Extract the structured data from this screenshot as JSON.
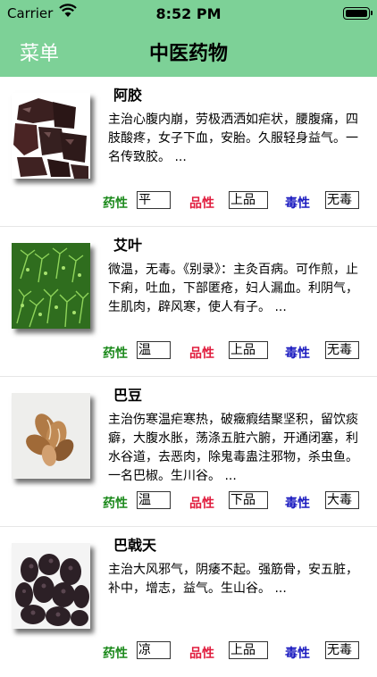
{
  "status_bar": {
    "carrier": "Carrier",
    "time": "8:52 PM"
  },
  "nav": {
    "menu_label": "菜单",
    "title": "中医药物"
  },
  "tag_labels": {
    "nature": "药性",
    "grade": "品性",
    "toxicity": "毒性"
  },
  "colors": {
    "nav_green": "#7dd197",
    "nature_label": "#1c8a1c",
    "grade_label": "#e01b3c",
    "toxicity_label": "#1a1abf"
  },
  "herbs": [
    {
      "name": "阿胶",
      "description": "主治心腹内崩，劳极洒洒如疟状，腰腹痛，四肢酸疼，女子下血，安胎。久服轻身益气。一名传致胶。 ...",
      "nature": "平",
      "grade": "上品",
      "toxicity": "无毒",
      "image": "ejiao-photo"
    },
    {
      "name": "艾叶",
      "description": "微温，无毒。《别录》：主灸百病。可作煎，止下痢，吐血，下部匿疮，妇人漏血。利阴气，生肌肉，辟风寒，使人有子。 ...",
      "nature": "温",
      "grade": "上品",
      "toxicity": "无毒",
      "image": "mugwort-photo"
    },
    {
      "name": "巴豆",
      "description": "主治伤寒温疟寒热，破癥瘕结聚坚积，留饮痰癖，大腹水胀，荡涤五脏六腑，开通闭塞，利水谷道，去恶肉，除鬼毒蛊注邪物，杀虫鱼。一名巴椒。生川谷。 ...",
      "nature": "温",
      "grade": "下品",
      "toxicity": "大毒",
      "image": "croton-seed-photo"
    },
    {
      "name": "巴戟天",
      "description": "主治大风邪气，阴痿不起。强筋骨，安五脏，补中，增志，益气。生山谷。 ...",
      "nature": "凉",
      "grade": "上品",
      "toxicity": "无毒",
      "image": "morinda-root-photo"
    }
  ]
}
